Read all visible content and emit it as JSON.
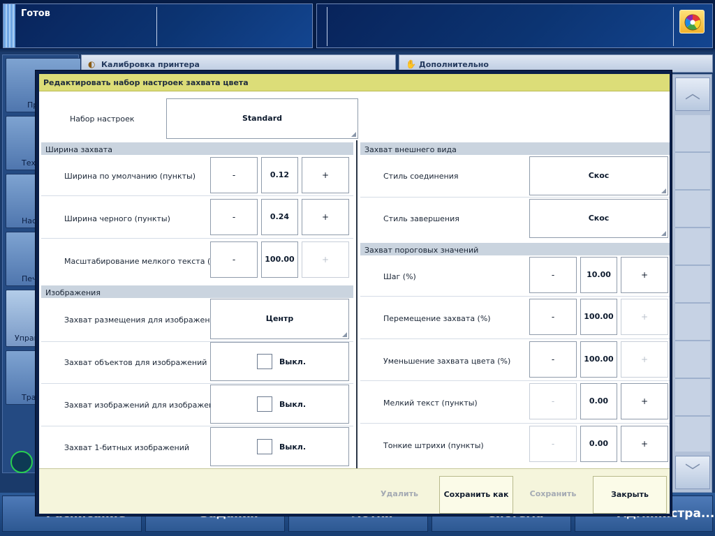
{
  "status": {
    "text": "Готов"
  },
  "colors": {
    "title_bar": "#dcdd78",
    "footer_bg": "#f5f5dc",
    "section_header": "#cad4df",
    "nav_blue": "#244a82"
  },
  "background": {
    "tabs": {
      "calibration": "Калибровка принтера",
      "advanced": "Дополнительно"
    },
    "nav_items": [
      "Пр",
      "Тех.",
      "Нас",
      "Печ",
      "Управ",
      "Тра"
    ],
    "bottom_tabs": [
      "Расписание",
      "Задания",
      "Лотки",
      "Система",
      "Администра..."
    ]
  },
  "dialog": {
    "title": "Редактировать набор настроек захвата цвета",
    "preset": {
      "label": "Набор настроек",
      "value": "Standard"
    },
    "trap_width": {
      "header": "Ширина захвата",
      "rows": [
        {
          "label": "Ширина по умолчанию (пункты)",
          "minus": "-",
          "value": "0.12",
          "plus": "+"
        },
        {
          "label": "Ширина черного (пункты)",
          "minus": "-",
          "value": "0.24",
          "plus": "+"
        },
        {
          "label": "Масштабирование мелкого текста (%)",
          "minus": "-",
          "value": "100.00",
          "plus": "+"
        }
      ]
    },
    "images": {
      "header": "Изображения",
      "placement": {
        "label": "Захват размещения для изображений",
        "value": "Центр"
      },
      "toggles": [
        {
          "label": "Захват объектов для изображений",
          "state": "Выкл."
        },
        {
          "label": "Захват изображений для изображений",
          "state": "Выкл."
        },
        {
          "label": "Захват 1-битных изображений",
          "state": "Выкл."
        }
      ]
    },
    "appearance": {
      "header": "Захват внешнего вида",
      "rows": [
        {
          "label": "Стиль соединения",
          "value": "Скос"
        },
        {
          "label": "Стиль завершения",
          "value": "Скос"
        }
      ]
    },
    "thresholds": {
      "header": "Захват пороговых значений",
      "rows": [
        {
          "label": "Шаг (%)",
          "minus": "-",
          "value": "10.00",
          "plus": "+"
        },
        {
          "label": "Перемещение захвата (%)",
          "minus": "-",
          "value": "100.00",
          "plus": "+"
        },
        {
          "label": "Уменьшение захвата цвета (%)",
          "minus": "-",
          "value": "100.00",
          "plus": "+"
        },
        {
          "label": "Мелкий текст (пункты)",
          "minus": "-",
          "value": "0.00",
          "plus": "+"
        },
        {
          "label": "Тонкие штрихи (пункты)",
          "minus": "-",
          "value": "0.00",
          "plus": "+"
        }
      ]
    },
    "footer": {
      "delete": "Удалить",
      "save_as": "Сохранить как",
      "save": "Сохранить",
      "close": "Закрыть"
    }
  }
}
